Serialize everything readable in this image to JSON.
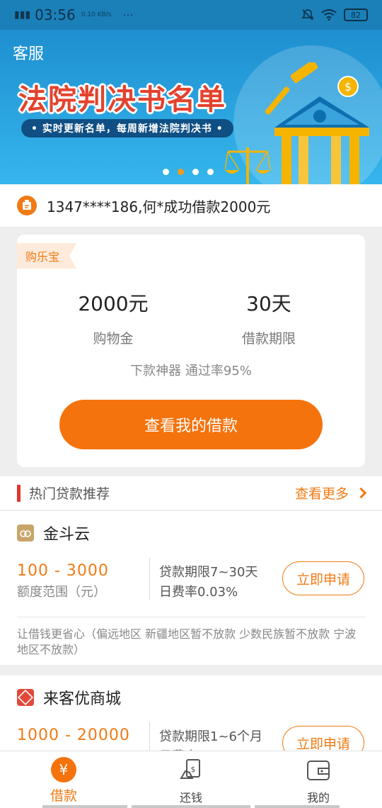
{
  "status_bar": {
    "time": "03:56",
    "speed": "0.10 KB/s",
    "more": "···",
    "battery": "82"
  },
  "banner": {
    "service_label": "客服",
    "title": "法院判决书名单",
    "subtitle": "• 实时更新名单，每周新增法院判决书 •",
    "dots_count": 4,
    "active_dot": 1,
    "colors": {
      "background": "#1e8fd0",
      "title": "#e3422d",
      "active_dot": "#f39a1a"
    }
  },
  "notice": {
    "text": "1347****186,何*成功借款2000元"
  },
  "product_card": {
    "tag": "购乐宝",
    "amount_value": "2000元",
    "amount_label": "购物金",
    "term_value": "30天",
    "term_label": "借款期限",
    "subtitle": "下款神器  通过率95%",
    "button": "查看我的借款"
  },
  "section": {
    "title": "热门贷款推荐",
    "more": "查看更多"
  },
  "loans": [
    {
      "name": "金斗云",
      "range": "100 - 3000",
      "range_label": "额度范围（元）",
      "term": "贷款期限7~30天",
      "rate": "日费率0.03%",
      "apply": "立即申请",
      "desc": "让借钱更省心（偏远地区 新疆地区暂不放款  少数民族暂不放款 宁波地区不放款）"
    },
    {
      "name": "来客优商城",
      "range": "1000 - 20000",
      "term": "贷款期限1~6个月",
      "rate": "日费率",
      "apply": "立即申请"
    }
  ],
  "tab_bar": {
    "items": [
      {
        "label": "借款",
        "icon": "yen-coin-icon",
        "active": true
      },
      {
        "label": "还钱",
        "icon": "repay-icon",
        "active": false
      },
      {
        "label": "我的",
        "icon": "wallet-icon",
        "active": false
      }
    ],
    "accent": "#f5730d"
  }
}
